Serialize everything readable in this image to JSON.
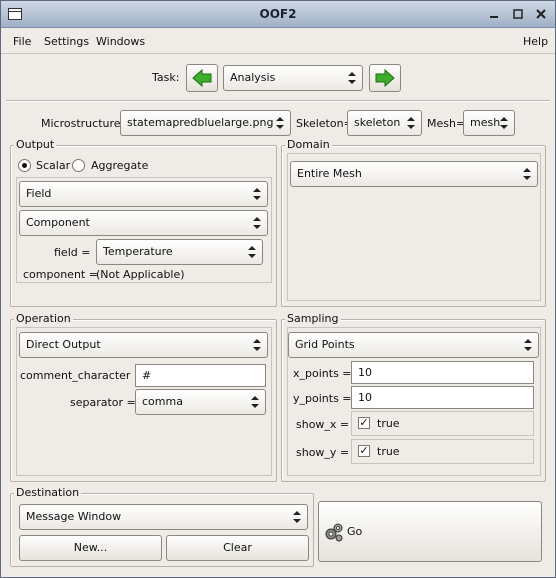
{
  "window": {
    "title": "OOF2"
  },
  "menubar": {
    "file": "File",
    "settings": "Settings",
    "windows": "Windows",
    "help": "Help"
  },
  "task": {
    "label": "Task:",
    "value": "Analysis"
  },
  "selectors": {
    "microstructure_label": "Microstructure=",
    "microstructure_value": "statemapredbluelarge.png",
    "skeleton_label": "Skeleton=",
    "skeleton_value": "skeleton",
    "mesh_label": "Mesh=",
    "mesh_value": "mesh"
  },
  "output": {
    "title": "Output",
    "scalar_label": "Scalar",
    "aggregate_label": "Aggregate",
    "selected": "Scalar",
    "field_combo": "Field",
    "component_combo": "Component",
    "field_label": "field =",
    "field_value": "Temperature",
    "component_label": "component =",
    "component_value": "(Not Applicable)"
  },
  "domain": {
    "title": "Domain",
    "value": "Entire Mesh"
  },
  "operation": {
    "title": "Operation",
    "value": "Direct Output",
    "comment_label": "comment_character =",
    "comment_value": "#",
    "separator_label": "separator =",
    "separator_value": "comma"
  },
  "sampling": {
    "title": "Sampling",
    "value": "Grid Points",
    "x_label": "x_points =",
    "x_value": "10",
    "y_label": "y_points =",
    "y_value": "10",
    "show_x_label": "show_x =",
    "show_x_value": "true",
    "show_y_label": "show_y =",
    "show_y_value": "true"
  },
  "destination": {
    "title": "Destination",
    "value": "Message Window",
    "new_label": "New...",
    "clear_label": "Clear"
  },
  "go": {
    "label": "Go"
  },
  "colors": {
    "arrow_green": "#3fae2a",
    "titlebar": "#b8c5d6"
  },
  "icons": {
    "prev": "left-arrow-icon",
    "next": "right-arrow-icon",
    "go": "gears-icon",
    "window_menu": "window-menu-icon",
    "minimize": "minimize-icon",
    "maximize": "maximize-icon",
    "close": "close-icon"
  }
}
